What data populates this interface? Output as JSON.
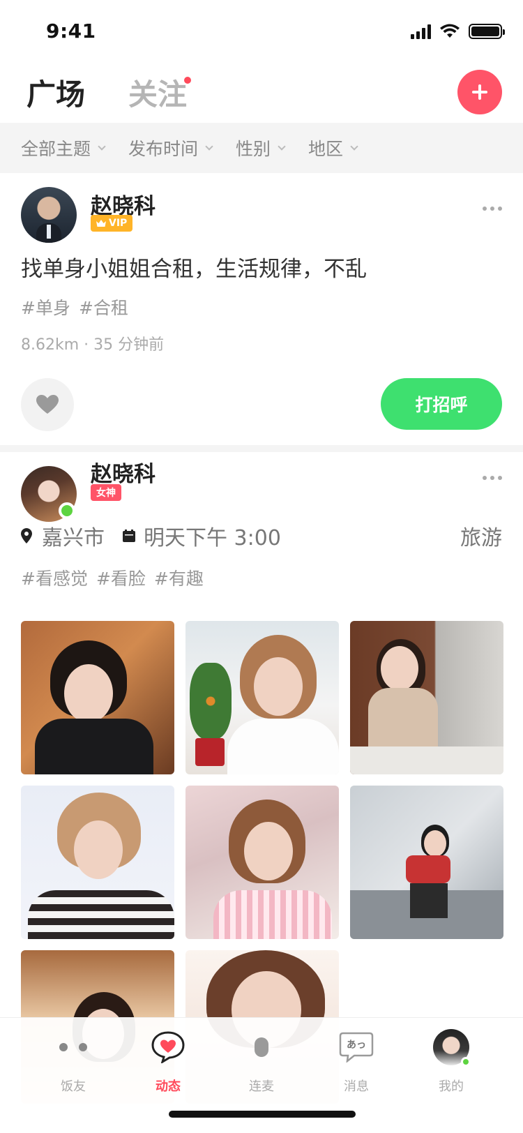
{
  "status_bar": {
    "time": "9:41"
  },
  "header": {
    "tab_active": "广场",
    "tab_inactive": "关注",
    "add_button_icon": "plus-icon"
  },
  "filters": [
    {
      "label": "全部主题"
    },
    {
      "label": "发布时间"
    },
    {
      "label": "性别"
    },
    {
      "label": "地区"
    }
  ],
  "post1": {
    "username": "赵晓科",
    "badge": "VIP",
    "text": "找单身小姐姐合租，生活规律，不乱",
    "tags": [
      "#单身",
      "#合租"
    ],
    "meta": "8.62km · 35 分钟前",
    "greet_label": "打招呼"
  },
  "post2": {
    "username": "赵晓科",
    "badge": "女神",
    "location": "嘉兴市",
    "time": "明天下午 3:00",
    "theme": "旅游",
    "tags": [
      "#看感觉",
      "#看脸",
      "#有趣"
    ],
    "photo_count": 8
  },
  "tabbar": {
    "items": [
      {
        "label": "饭友",
        "icon": "friends-icon"
      },
      {
        "label": "动态",
        "icon": "moments-heart-icon"
      },
      {
        "label": "连麦",
        "icon": "mic-icon"
      },
      {
        "label": "消息",
        "icon": "message-icon",
        "icon_text": "あっ"
      },
      {
        "label": "我的",
        "icon": "profile-avatar-icon"
      }
    ],
    "active_index": 1
  },
  "colors": {
    "accent": "#ff5468",
    "greet": "#3ee06f",
    "vip": "#ffb428",
    "online": "#5dd440"
  }
}
